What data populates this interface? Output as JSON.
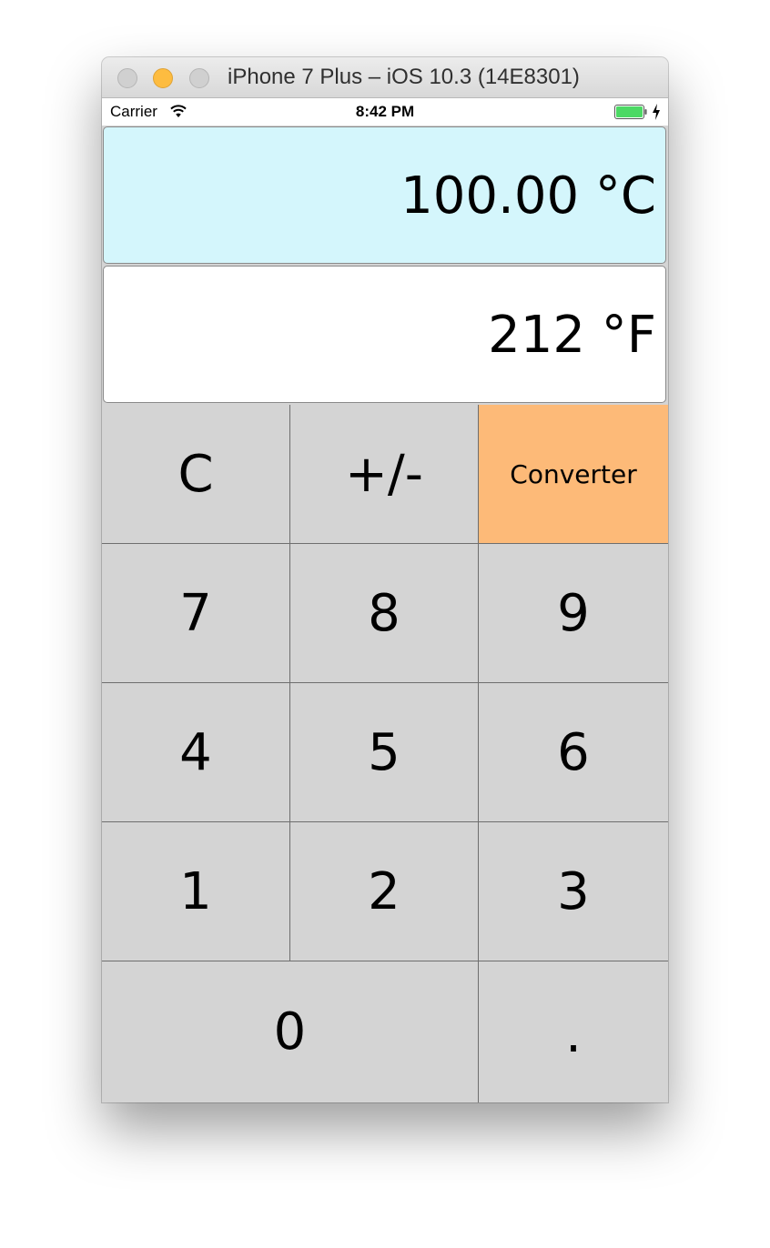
{
  "window": {
    "title": "iPhone 7 Plus – iOS 10.3 (14E8301)"
  },
  "status_bar": {
    "carrier": "Carrier",
    "time": "8:42 PM",
    "battery_color": "#4cd964"
  },
  "displays": {
    "celsius": "100.00 °C",
    "fahrenheit": "212 °F"
  },
  "keypad": {
    "rows": [
      [
        "C",
        "+/-",
        "Converter"
      ],
      [
        "7",
        "8",
        "9"
      ],
      [
        "4",
        "5",
        "6"
      ],
      [
        "1",
        "2",
        "3"
      ],
      [
        "0",
        "."
      ]
    ]
  },
  "colors": {
    "celsius_display_bg": "#d4f6fc",
    "converter_key_bg": "#fdba78",
    "key_bg": "#d4d4d4"
  }
}
